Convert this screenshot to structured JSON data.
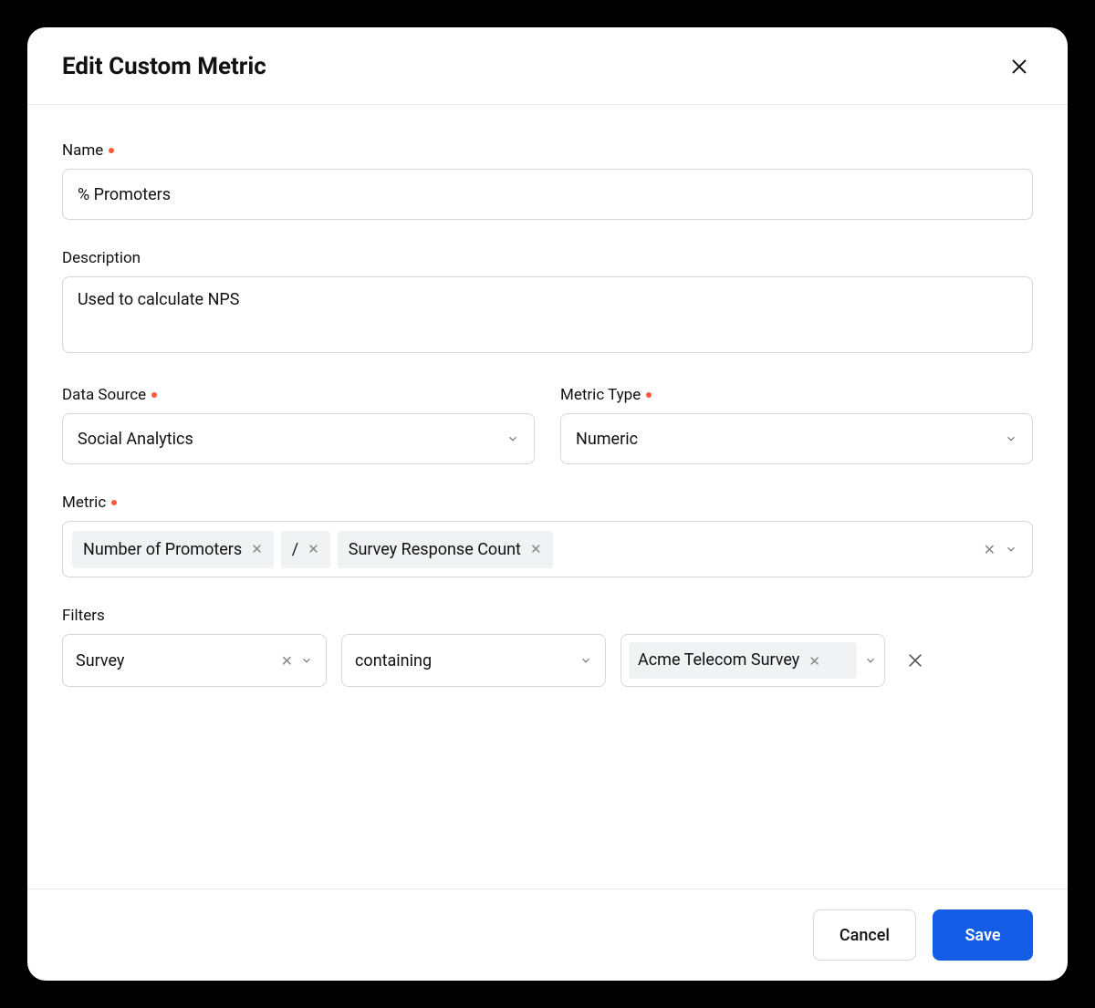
{
  "modal": {
    "title": "Edit Custom Metric"
  },
  "fields": {
    "name": {
      "label": "Name",
      "value": "% Promoters",
      "required": true
    },
    "description": {
      "label": "Description",
      "value": "Used to calculate NPS",
      "required": false
    },
    "dataSource": {
      "label": "Data Source",
      "value": "Social Analytics",
      "required": true
    },
    "metricType": {
      "label": "Metric Type",
      "value": "Numeric",
      "required": true
    },
    "metric": {
      "label": "Metric",
      "required": true,
      "tokens": [
        "Number of Promoters",
        "/",
        "Survey Response Count"
      ]
    },
    "filters": {
      "label": "Filters",
      "rows": [
        {
          "field": "Survey",
          "operator": "containing",
          "value": "Acme Telecom Survey"
        }
      ]
    }
  },
  "footer": {
    "cancel": "Cancel",
    "save": "Save"
  }
}
